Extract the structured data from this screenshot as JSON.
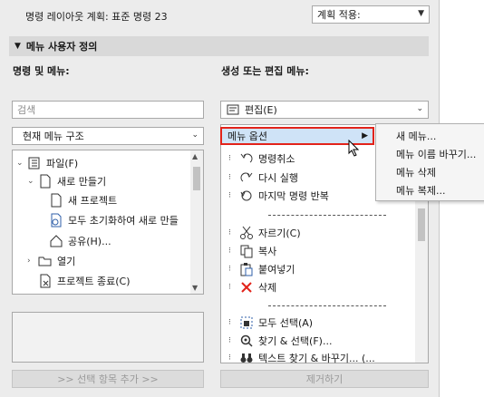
{
  "top": {
    "command_scheme_label": "명령 레이아웃 계획: 표준 명령 23",
    "apply_scheme_label": "계획 적용:"
  },
  "section": {
    "title": "메뉴 사용자 정의"
  },
  "left": {
    "heading": "명령 및 메뉴:",
    "search_placeholder": "검색",
    "structure_select": "현재 메뉴 구조",
    "tree": [
      {
        "label": "파일(F)"
      },
      {
        "label": "새로 만들기"
      },
      {
        "label": "새 프로젝트"
      },
      {
        "label": "모두 초기화하여 새로 만들"
      },
      {
        "label": "공유(H)..."
      },
      {
        "label": "열기"
      },
      {
        "label": "프로젝트 종료(C)"
      }
    ],
    "add_button": ">> 선택 항목 추가 >>"
  },
  "right": {
    "heading": "생성 또는 편집 메뉴:",
    "menu_select": "편집(E)",
    "menu_options_label": "메뉴 옵션",
    "commands": [
      {
        "label": "명령취소"
      },
      {
        "label": "다시 실행"
      },
      {
        "label": "마지막 명령 반복"
      },
      {
        "label": "자르기(C)"
      },
      {
        "label": "복사"
      },
      {
        "label": "붙여넣기"
      },
      {
        "label": "삭제"
      },
      {
        "label": "모두 선택(A)"
      },
      {
        "label": "찾기 & 선택(F)..."
      },
      {
        "label": "텍스트 찾기 & 바꾸기... (..."
      }
    ],
    "remove_button": "제거하기"
  },
  "popup_menu": {
    "items": [
      {
        "label": "새 메뉴..."
      },
      {
        "label": "메뉴 이름 바꾸기..."
      },
      {
        "label": "메뉴 삭제"
      },
      {
        "label": "메뉴 복제..."
      }
    ]
  },
  "colors": {
    "highlight": "#cfe3f7",
    "highlight_border": "#e2231a",
    "delete_icon": "#e2231a"
  }
}
